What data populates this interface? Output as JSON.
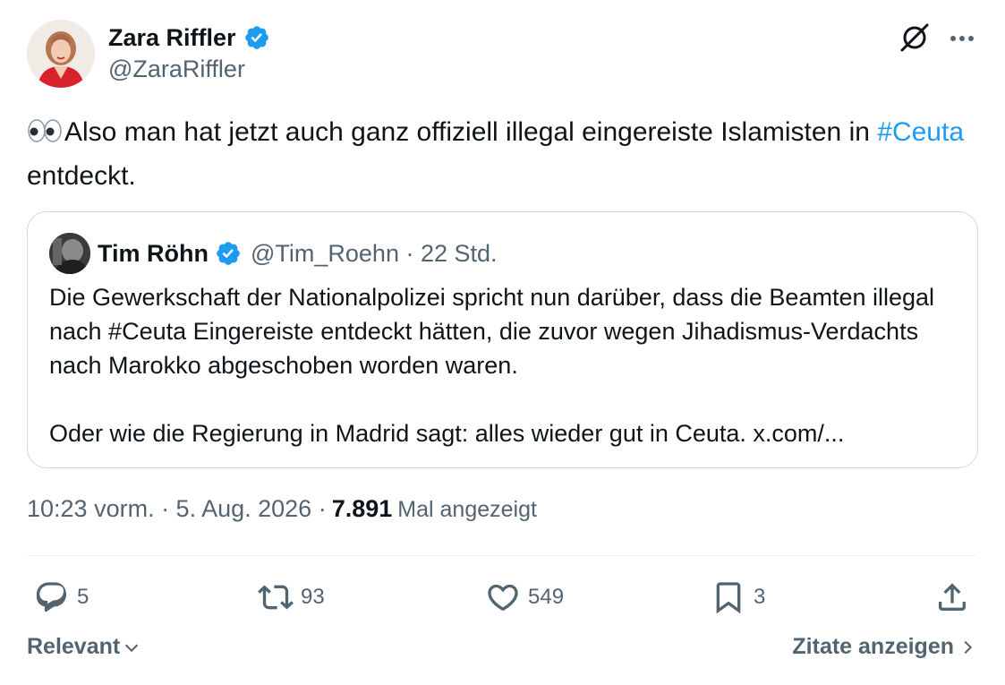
{
  "author": {
    "display_name": "Zara Riffler",
    "handle": "@ZaraRiffler",
    "verified": true
  },
  "tweet": {
    "text_before": "Also man hat jetzt auch ganz offiziell illegal eingereiste Islamisten in ",
    "hashtag": "#Ceuta",
    "text_after": " entdeckt.",
    "emoji": "👀"
  },
  "quote": {
    "display_name": "Tim Röhn",
    "handle": "@Tim_Roehn · 22 Std.",
    "text": "Die Gewerkschaft der Nationalpolizei spricht nun darüber, dass die Beamten illegal nach #Ceuta Eingereiste entdeckt hätten, die zuvor wegen Jihadismus-Verdachts nach Marokko abgeschoben worden waren.\n\nOder wie die Regierung in Madrid sagt: alles wieder gut in Ceuta. x.com/..."
  },
  "meta": {
    "time_date": "10:23 vorm. · 5. Aug. 2026 ·",
    "views_count": "7.891",
    "views_label": "Mal angezeigt"
  },
  "actions": {
    "replies": "5",
    "reposts": "93",
    "likes": "549",
    "bookmarks": "3"
  },
  "footer": {
    "sort_label": "Relevant",
    "quotes_label": "Zitate anzeigen"
  },
  "colors": {
    "accent": "#1d9bf0",
    "secondary_text": "#536471",
    "primary_text": "#0f1419",
    "border": "#cfd9de",
    "avatar_red": "#d8222b"
  }
}
